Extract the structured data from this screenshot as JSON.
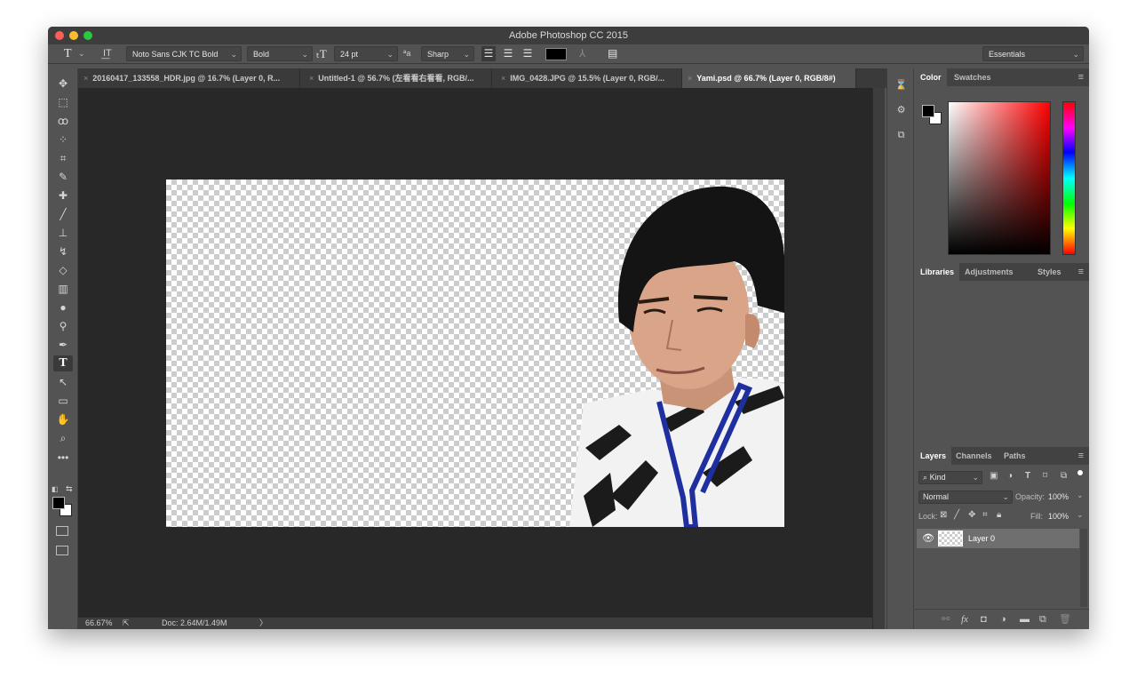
{
  "window": {
    "title": "Adobe Photoshop CC 2015",
    "traffic_colors": [
      "#fc5f57",
      "#fdbc2e",
      "#28c840"
    ]
  },
  "options_bar": {
    "tool_glyph": "T",
    "font_family": "Noto Sans CJK TC Bold",
    "font_style": "Bold",
    "font_size": "24 pt",
    "aa_glyph": "ªa",
    "anti_alias": "Sharp",
    "color_swatch": "#000000",
    "workspace": "Essentials"
  },
  "tabs": [
    {
      "label": "20160417_133558_HDR.jpg @ 16.7% (Layer 0, R..."
    },
    {
      "label": "Untitled-1 @ 56.7% (左看看右看看, RGB/..."
    },
    {
      "label": "IMG_0428.JPG @ 15.5% (Layer 0, RGB/..."
    },
    {
      "label": "Yami.psd @ 66.7% (Layer 0, RGB/8#)",
      "active": true
    }
  ],
  "tools": [
    {
      "name": "move-tool",
      "glyph": "✥"
    },
    {
      "name": "marquee-tool",
      "glyph": "⬚"
    },
    {
      "name": "lasso-tool",
      "glyph": "ꝏ"
    },
    {
      "name": "quick-selection-tool",
      "glyph": "⁘"
    },
    {
      "name": "crop-tool",
      "glyph": "⌗"
    },
    {
      "name": "eyedropper-tool",
      "glyph": "✎"
    },
    {
      "name": "healing-brush-tool",
      "glyph": "✚"
    },
    {
      "name": "brush-tool",
      "glyph": "╱"
    },
    {
      "name": "clone-stamp-tool",
      "glyph": "⊥"
    },
    {
      "name": "history-brush-tool",
      "glyph": "↯"
    },
    {
      "name": "eraser-tool",
      "glyph": "◇"
    },
    {
      "name": "gradient-tool",
      "glyph": "▥"
    },
    {
      "name": "blur-tool",
      "glyph": "●"
    },
    {
      "name": "dodge-tool",
      "glyph": "⚲"
    },
    {
      "name": "pen-tool",
      "glyph": "✒"
    },
    {
      "name": "type-tool",
      "glyph": "T",
      "active": true
    },
    {
      "name": "path-selection-tool",
      "glyph": "↖"
    },
    {
      "name": "rectangle-tool",
      "glyph": "▭"
    },
    {
      "name": "hand-tool",
      "glyph": "✋"
    },
    {
      "name": "zoom-tool",
      "glyph": "⌕"
    },
    {
      "name": "edit-toolbar",
      "glyph": "•••"
    }
  ],
  "foreground_color": "#000000",
  "background_color": "#ffffff",
  "status": {
    "zoom": "66.67%",
    "doc_info": "Doc: 2.64M/1.49M",
    "arrow": "〉"
  },
  "dock_icons": [
    {
      "name": "history-icon",
      "glyph": "⌛"
    },
    {
      "name": "properties-icon",
      "glyph": "⚙"
    },
    {
      "name": "adjustments-panel-icon",
      "glyph": "⧉"
    }
  ],
  "color_panel": {
    "tabs": [
      "Color",
      "Swatches"
    ]
  },
  "libraries_panel": {
    "tabs": [
      "Libraries",
      "Adjustments",
      "Styles"
    ]
  },
  "layers_panel": {
    "tabs": [
      "Layers",
      "Channels",
      "Paths"
    ],
    "filter": "Kind",
    "blend_mode": "Normal",
    "opacity_label": "Opacity:",
    "opacity_value": "100%",
    "lock_label": "Lock:",
    "fill_label": "Fill:",
    "fill_value": "100%",
    "layers": [
      {
        "name": "Layer 0",
        "visible": true
      }
    ],
    "bottom_icons": [
      "link-icon",
      "fx-icon",
      "mask-icon",
      "adjustment-icon",
      "group-folder-icon",
      "new-layer-icon",
      "trash-icon"
    ]
  },
  "menu_glyph": "≡"
}
